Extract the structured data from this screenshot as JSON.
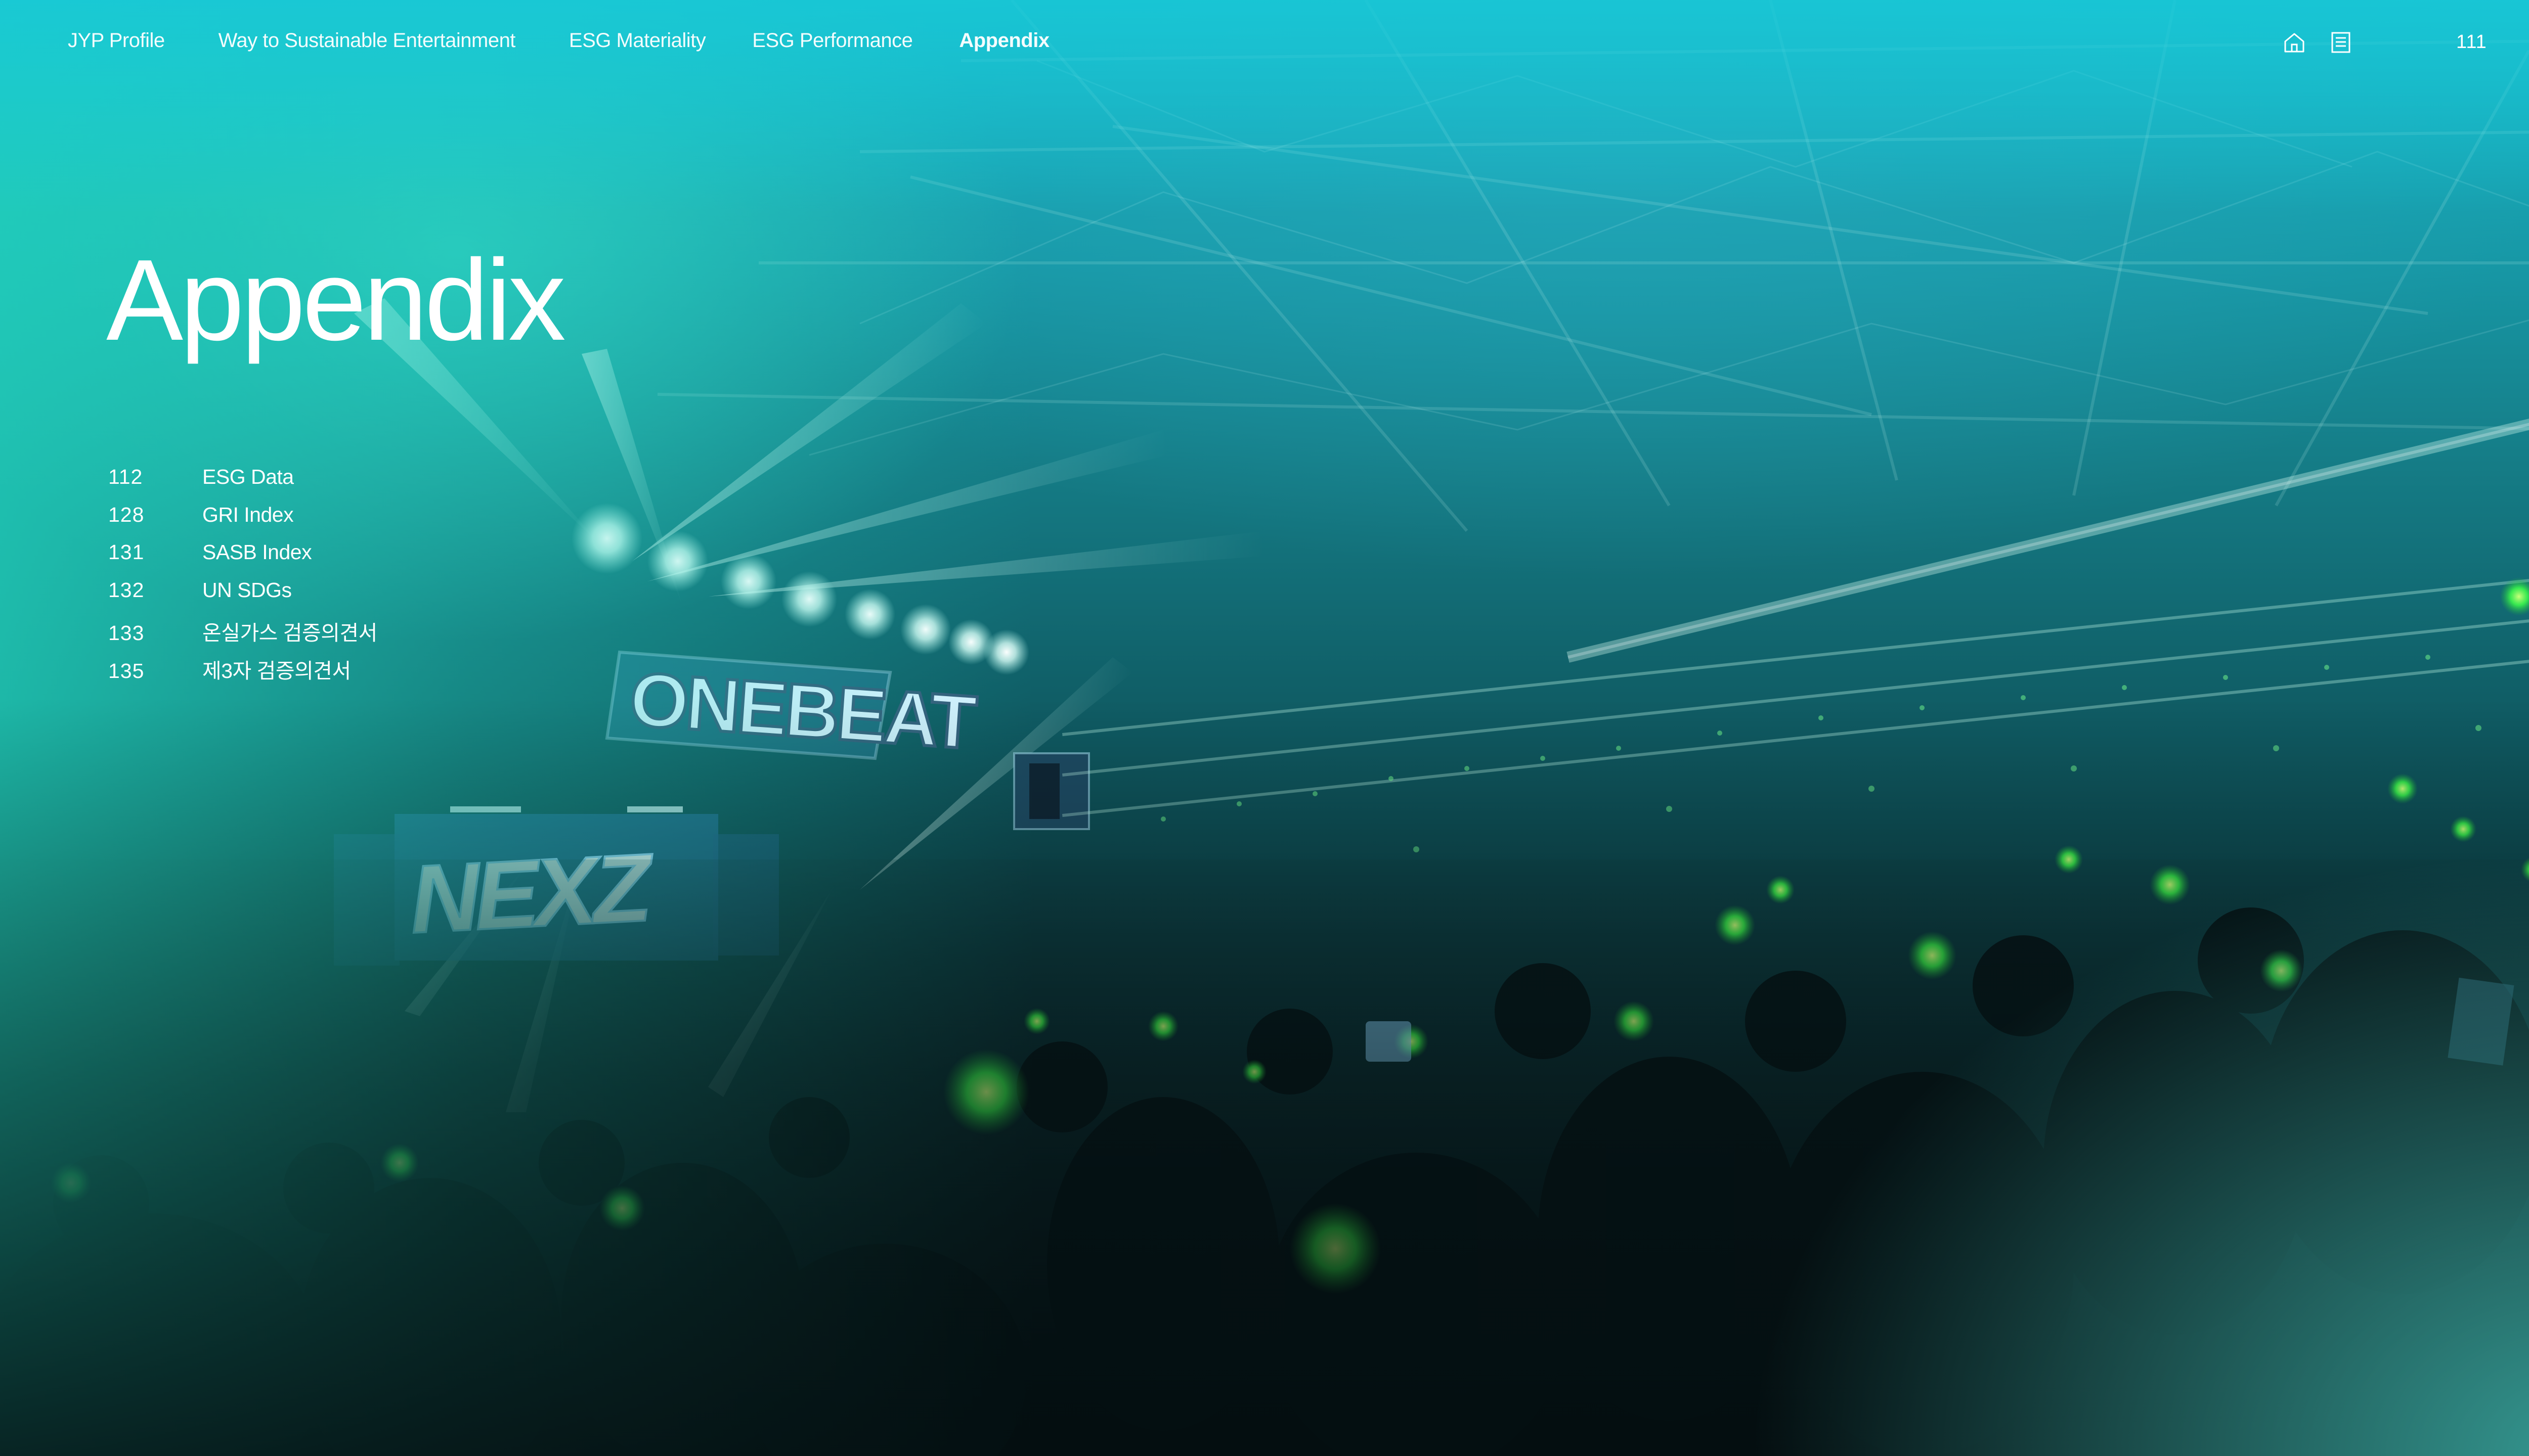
{
  "nav": {
    "items": [
      {
        "label": "JYP Profile",
        "active": false
      },
      {
        "label": "Way to Sustainable Entertainment",
        "active": false
      },
      {
        "label": "ESG Materiality",
        "active": false
      },
      {
        "label": "ESG Performance",
        "active": false
      },
      {
        "label": "Appendix",
        "active": true
      }
    ],
    "icons": [
      "home-icon",
      "document-list-icon"
    ],
    "page_number": "111"
  },
  "page_title": "Appendix",
  "toc": [
    {
      "page": "112",
      "label": "ESG Data"
    },
    {
      "page": "128",
      "label": "GRI Index"
    },
    {
      "page": "131",
      "label": "SASB Index"
    },
    {
      "page": "132",
      "label": "UN SDGs"
    },
    {
      "page": "133",
      "label": "온실가스 검증의견서"
    },
    {
      "page": "135",
      "label": "제3자 검증의견서"
    }
  ],
  "background": {
    "stage_screen_top": "ONEBEAT",
    "stage_screen_bottom": "NEXZ",
    "colors": {
      "teal_top": "#18b7c8",
      "mint_left": "#22d6be",
      "deep": "#081e22",
      "lightstick_green": "#3dff4a"
    }
  }
}
